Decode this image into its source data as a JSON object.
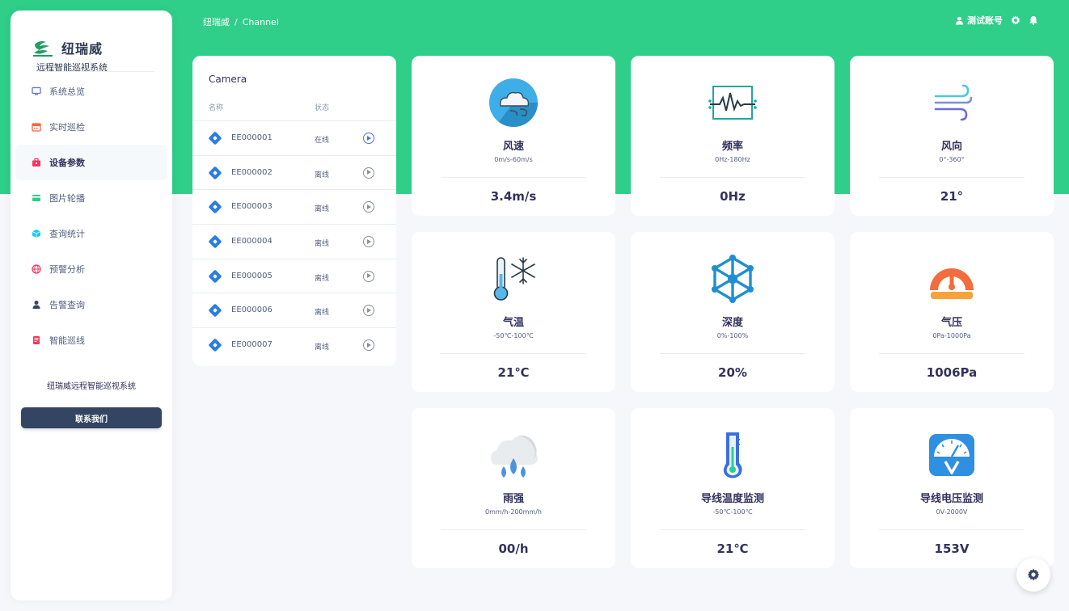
{
  "brand": {
    "name": "纽瑞威",
    "subtitle": "远程智能巡视系统"
  },
  "sidebar": {
    "items": [
      {
        "label": "系统总览",
        "icon": "monitor-icon",
        "color": "#5e72e4"
      },
      {
        "label": "实时巡检",
        "icon": "calendar-icon",
        "color": "#fb6340"
      },
      {
        "label": "设备参数",
        "icon": "briefcase-icon",
        "color": "#f5365c",
        "active": true
      },
      {
        "label": "图片轮播",
        "icon": "credit-card-icon",
        "color": "#2dce89"
      },
      {
        "label": "查询统计",
        "icon": "cube-icon",
        "color": "#11cdef"
      },
      {
        "label": "预警分析",
        "icon": "globe-icon",
        "color": "#f5365c"
      },
      {
        "label": "告警查询",
        "icon": "user-icon",
        "color": "#344563"
      },
      {
        "label": "智能巡线",
        "icon": "book-icon",
        "color": "#f5365c"
      }
    ],
    "footer_title": "纽瑞威远程智能巡视系统",
    "contact_label": "联系我们"
  },
  "header": {
    "breadcrumb_root": "纽瑞威",
    "breadcrumb_sep": "/",
    "breadcrumb_current": "Channel",
    "account_label": "测试账号"
  },
  "camera": {
    "title": "Camera",
    "col_name": "名称",
    "col_status": "状态",
    "rows": [
      {
        "id": "EE000001",
        "status": "在线",
        "online": true
      },
      {
        "id": "EE000002",
        "status": "离线",
        "online": false
      },
      {
        "id": "EE000003",
        "status": "离线",
        "online": false
      },
      {
        "id": "EE000004",
        "status": "离线",
        "online": false
      },
      {
        "id": "EE000005",
        "status": "离线",
        "online": false
      },
      {
        "id": "EE000006",
        "status": "离线",
        "online": false
      },
      {
        "id": "EE000007",
        "status": "离线",
        "online": false
      }
    ]
  },
  "metrics": [
    {
      "name": "风速",
      "range": "0m/s-60m/s",
      "value": "3.4m/s",
      "icon": "cloud-wind-icon"
    },
    {
      "name": "频率",
      "range": "0Hz-180Hz",
      "value": "0Hz",
      "icon": "waveform-icon"
    },
    {
      "name": "风向",
      "range": "0°-360°",
      "value": "21°",
      "icon": "wind-icon"
    },
    {
      "name": "气温",
      "range": "-50℃-100℃",
      "value": "21℃",
      "icon": "thermometer-snow-icon"
    },
    {
      "name": "深度",
      "range": "0%-100%",
      "value": "20%",
      "icon": "molecule-icon"
    },
    {
      "name": "气压",
      "range": "0Pa-1000Pa",
      "value": "1006Pa",
      "icon": "gauge-icon"
    },
    {
      "name": "雨强",
      "range": "0mm/h-200mm/h",
      "value": "00/h",
      "icon": "rain-cloud-icon"
    },
    {
      "name": "导线温度监测",
      "range": "-50℃-100℃",
      "value": "21℃",
      "icon": "thermometer-icon"
    },
    {
      "name": "导线电压监测",
      "range": "0V-2000V",
      "value": "153V",
      "icon": "voltmeter-icon"
    }
  ],
  "colors": {
    "header_green": "#2fce89",
    "primary_dark": "#344563",
    "accent_blue": "#2a7de1"
  }
}
